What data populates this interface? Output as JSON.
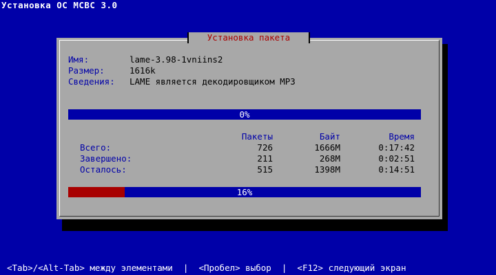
{
  "window_title": "Установка ОС МСВС 3.0",
  "dialog": {
    "title": "Установка пакета",
    "info": {
      "name_label": "Имя:",
      "name_value": "lame-3.98-1vniins2",
      "size_label": "Размер:",
      "size_value": "1616k",
      "details_label": "Сведения:",
      "details_value": "LAME является декодировщиком MP3"
    },
    "package_progress": {
      "percent": 0,
      "label": "0%"
    },
    "stats": {
      "headers": {
        "packages": "Пакеты",
        "bytes": "Байт",
        "time": "Время"
      },
      "rows": [
        {
          "label": "Всего:",
          "packages": "726",
          "bytes": "1666M",
          "time": "0:17:42"
        },
        {
          "label": "Завершено:",
          "packages": "211",
          "bytes": "268M",
          "time": "0:02:51"
        },
        {
          "label": "Осталось:",
          "packages": "515",
          "bytes": "1398M",
          "time": "0:14:51"
        }
      ]
    },
    "total_progress": {
      "percent": 16,
      "label": "16%"
    }
  },
  "footer": "<Tab>/<Alt-Tab> между элементами  |  <Пробел> выбор  |  <F12> следующий экран",
  "colors": {
    "background": "#0000a8",
    "dialog": "#a8a8a8",
    "accent_red": "#a80000",
    "label_blue": "#0000a8"
  }
}
